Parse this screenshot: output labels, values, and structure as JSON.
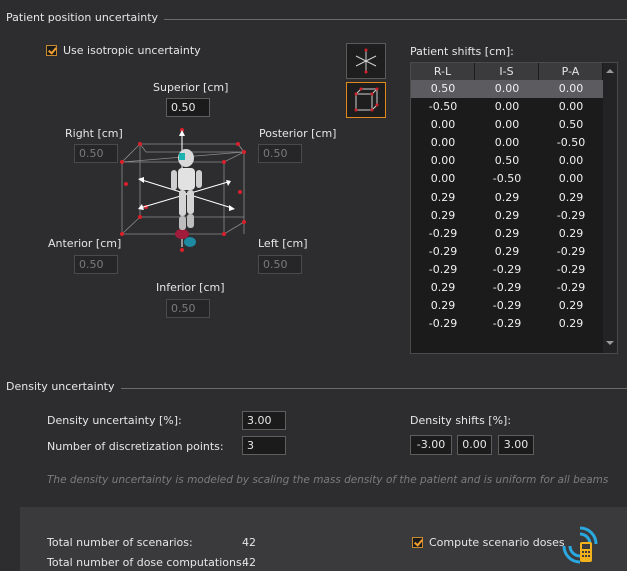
{
  "patient_section": {
    "title": "Patient position uncertainty",
    "isotropic_label": "Use isotropic uncertainty",
    "superior_label": "Superior [cm]",
    "superior_value": "0.50",
    "right_label": "Right [cm]",
    "right_value": "0.50",
    "posterior_label": "Posterior [cm]",
    "posterior_value": "0.50",
    "anterior_label": "Anterior [cm]",
    "anterior_value": "0.50",
    "left_label": "Left [cm]",
    "left_value": "0.50",
    "inferior_label": "Inferior [cm]",
    "inferior_value": "0.50",
    "view_buttons": [
      "axes-view-icon",
      "cube-view-icon"
    ]
  },
  "shifts_table": {
    "title": "Patient shifts [cm]:",
    "columns": [
      "R-L",
      "I-S",
      "P-A"
    ],
    "rows": [
      [
        "0.50",
        "0.00",
        "0.00"
      ],
      [
        "-0.50",
        "0.00",
        "0.00"
      ],
      [
        "0.00",
        "0.00",
        "0.50"
      ],
      [
        "0.00",
        "0.00",
        "-0.50"
      ],
      [
        "0.00",
        "0.50",
        "0.00"
      ],
      [
        "0.00",
        "-0.50",
        "0.00"
      ],
      [
        "0.29",
        "0.29",
        "0.29"
      ],
      [
        "0.29",
        "0.29",
        "-0.29"
      ],
      [
        "-0.29",
        "0.29",
        "0.29"
      ],
      [
        "-0.29",
        "0.29",
        "-0.29"
      ],
      [
        "-0.29",
        "-0.29",
        "-0.29"
      ],
      [
        "0.29",
        "-0.29",
        "-0.29"
      ],
      [
        "0.29",
        "-0.29",
        "0.29"
      ],
      [
        "-0.29",
        "-0.29",
        "0.29"
      ]
    ]
  },
  "density_section": {
    "title": "Density uncertainty",
    "uncertainty_label": "Density uncertainty [%]:",
    "uncertainty_value": "3.00",
    "points_label": "Number of discretization points:",
    "points_value": "3",
    "shifts_label": "Density shifts [%]:",
    "shifts": [
      "-3.00",
      "0.00",
      "3.00"
    ],
    "note": "The density uncertainty is modeled by scaling the mass density of the patient and is uniform for all beams"
  },
  "summary": {
    "scenarios_label": "Total number of scenarios:",
    "scenarios_value": "42",
    "computations_label": "Total number of dose computations:",
    "computations_value": "42",
    "compute_label": "Compute scenario doses"
  },
  "colors": {
    "accent": "#e08a1e",
    "background": "#2d2d30"
  }
}
